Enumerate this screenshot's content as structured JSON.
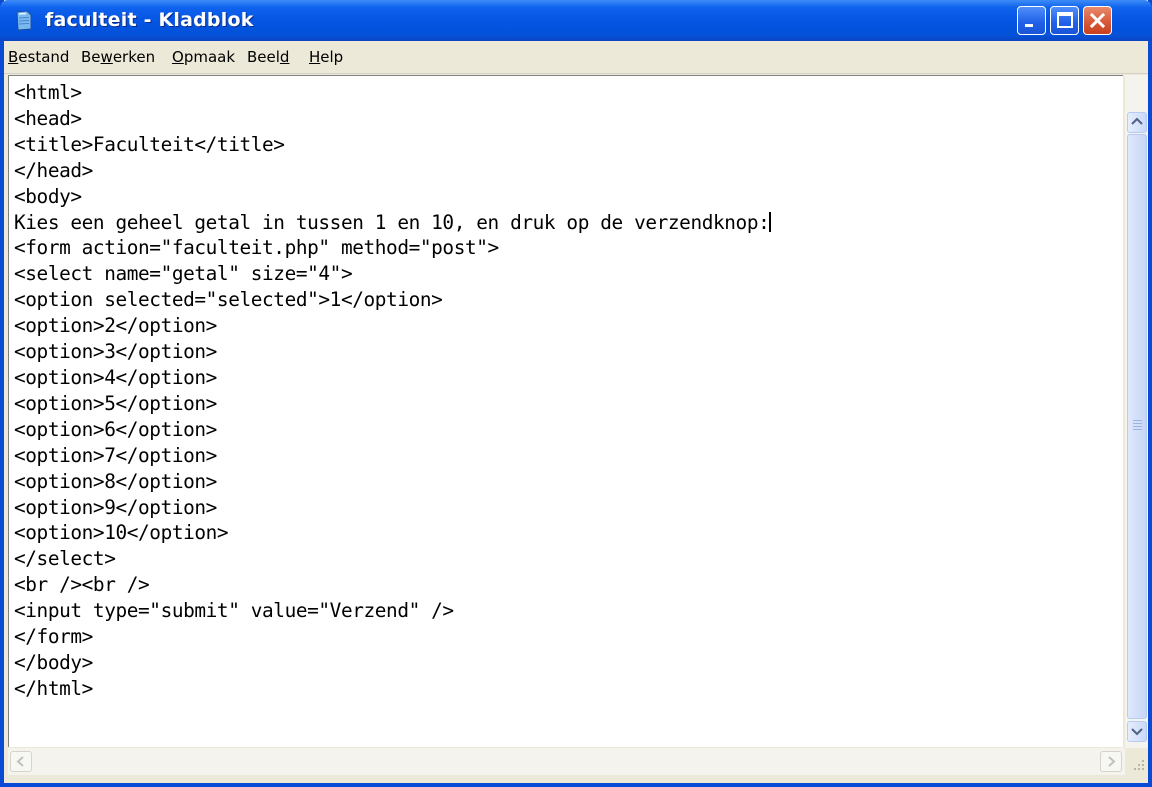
{
  "window": {
    "title": "faculteit - Kladblok",
    "icon": "notepad-icon",
    "controls": [
      "minimize-icon",
      "maximize-icon",
      "close-icon"
    ],
    "accent_color": "#0a4bd6"
  },
  "menu": [
    {
      "pre": "",
      "key": "B",
      "post": "estand"
    },
    {
      "pre": "Be",
      "key": "w",
      "post": "erken"
    },
    {
      "pre": "",
      "key": "O",
      "post": "pmaak"
    },
    {
      "pre": "Beel",
      "key": "d",
      "post": ""
    },
    {
      "pre": "",
      "key": "H",
      "post": "elp"
    }
  ],
  "editor": {
    "lines": [
      "<html>",
      "<head>",
      "<title>Faculteit</title>",
      "</head>",
      "<body>",
      "Kies een geheel getal in tussen 1 en 10, en druk op de verzendknop:",
      "<form action=\"faculteit.php\" method=\"post\">",
      "<select name=\"getal\" size=\"4\">",
      "<option selected=\"selected\">1</option>",
      "<option>2</option>",
      "<option>3</option>",
      "<option>4</option>",
      "<option>5</option>",
      "<option>6</option>",
      "<option>7</option>",
      "<option>8</option>",
      "<option>9</option>",
      "<option>10</option>",
      "</select>",
      "<br /><br />",
      "<input type=\"submit\" value=\"Verzend\" />",
      "</form>",
      "</body>",
      "</html>"
    ],
    "caret_line": 5
  },
  "scrollbars": {
    "vertical": [
      "up-arrow-icon",
      "down-arrow-icon"
    ],
    "horizontal": [
      "left-arrow-icon",
      "right-arrow-icon"
    ]
  }
}
